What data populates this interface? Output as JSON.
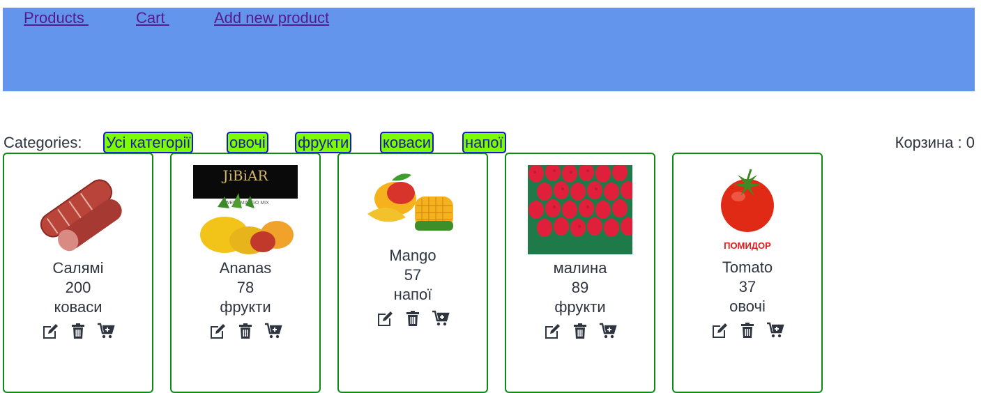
{
  "nav": {
    "products": "Products ",
    "cart": "Cart ",
    "add_product": "Add new product"
  },
  "categories_label": "Categories:",
  "categories": [
    "Усі категорії",
    "овочі",
    "фрукти",
    "коваси",
    "напої"
  ],
  "cart_label": "Корзина : 0",
  "products": [
    {
      "name": "Салямі",
      "price": "200",
      "category": "коваси",
      "image": "salami-image"
    },
    {
      "name": "Ananas",
      "price": "78",
      "category": "фрукти",
      "image": "jibiar-mango-pineapple-image",
      "image_text": "JiBiAR"
    },
    {
      "name": "Mango",
      "price": "57",
      "category": "напої",
      "image": "mango-image"
    },
    {
      "name": "малина",
      "price": "89",
      "category": "фрукти",
      "image": "raspberry-image"
    },
    {
      "name": "Tomato",
      "price": "37",
      "category": "овочі",
      "image": "tomato-image",
      "image_text": "ПОМИДОР"
    }
  ],
  "colors": {
    "header": "#6495ed",
    "category_button": "#7cfc00",
    "category_border": "#1515d8",
    "card_border": "#118a11",
    "link": "#551a8b"
  },
  "icons": [
    "edit-icon",
    "trash-icon",
    "cart-plus-icon"
  ]
}
